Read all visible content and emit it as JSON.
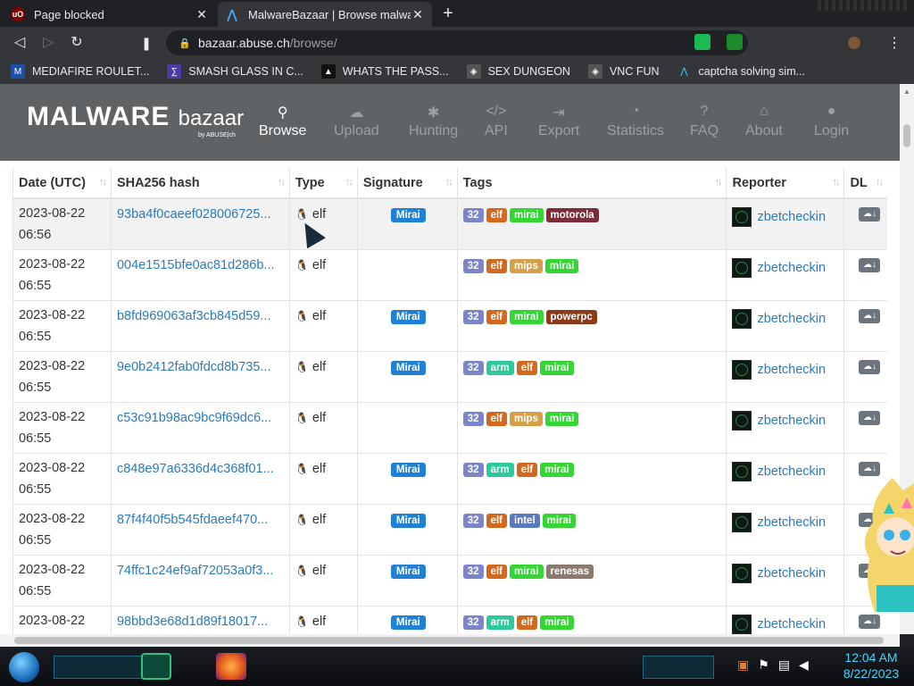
{
  "browser": {
    "tabs": [
      {
        "label": "Page blocked",
        "icon": "ublock-icon"
      },
      {
        "label": "MalwareBazaar | Browse malware s",
        "icon": "malwarebazaar-icon"
      }
    ],
    "new_tab_label": "+",
    "close_symbol": "✕",
    "url_domain": "bazaar.abuse.ch",
    "url_path": "/browse/",
    "bookmarks": [
      {
        "label": "MEDIAFIRE ROULET...",
        "icon": "mediafire-icon",
        "color": "#1d4fa8"
      },
      {
        "label": "SMASH GLASS IN C...",
        "icon": "visual-studio-icon",
        "color": "#4b3aa8"
      },
      {
        "label": "WHATS THE PASS...",
        "icon": "mask-icon",
        "color": "#222222"
      },
      {
        "label": "SEX DUNGEON",
        "icon": "cube-icon",
        "color": "#555555"
      },
      {
        "label": "VNC FUN",
        "icon": "cube-icon",
        "color": "#555555"
      },
      {
        "label": "captcha solving sim...",
        "icon": "caret-icon",
        "color": "#35363a"
      }
    ]
  },
  "site": {
    "logo_main": "MALWARE",
    "logo_sub": "bazaar",
    "logo_by": "by ABUSE|ch",
    "nav": [
      {
        "label": "Browse",
        "icon": "search-icon",
        "glyph": "🔍",
        "active": true
      },
      {
        "label": "Upload",
        "icon": "cloud-upload-icon",
        "glyph": "☁",
        "active": false
      },
      {
        "label": "Hunting",
        "icon": "bug-icon",
        "glyph": "✱",
        "active": false
      },
      {
        "label": "API",
        "icon": "code-icon",
        "glyph": "</>",
        "active": false
      },
      {
        "label": "Export",
        "icon": "export-icon",
        "glyph": "⇥",
        "active": false
      },
      {
        "label": "Statistics",
        "icon": "pie-chart-icon",
        "glyph": "◔",
        "active": false
      },
      {
        "label": "FAQ",
        "icon": "question-icon",
        "glyph": "?",
        "active": false
      },
      {
        "label": "About",
        "icon": "building-icon",
        "glyph": "⌂",
        "active": false
      },
      {
        "label": "Login",
        "icon": "user-icon",
        "glyph": "●",
        "active": false
      }
    ]
  },
  "table": {
    "headers": [
      "Date (UTC)",
      "SHA256 hash",
      "Type",
      "Signature",
      "Tags",
      "Reporter",
      "DL"
    ],
    "rows": [
      {
        "date": "2023-08-22",
        "time": "06:56",
        "hash": "93ba4f0caeef028006725...",
        "type": "elf",
        "signature": "Mirai",
        "tags": [
          "32",
          "elf",
          "mirai",
          "motorola"
        ],
        "reporter": "zbetcheckin"
      },
      {
        "date": "2023-08-22",
        "time": "06:55",
        "hash": "004e1515bfe0ac81d286b...",
        "type": "elf",
        "signature": "",
        "tags": [
          "32",
          "elf",
          "mips",
          "mirai"
        ],
        "reporter": "zbetcheckin"
      },
      {
        "date": "2023-08-22",
        "time": "06:55",
        "hash": "b8fd969063af3cb845d59...",
        "type": "elf",
        "signature": "Mirai",
        "tags": [
          "32",
          "elf",
          "mirai",
          "powerpc"
        ],
        "reporter": "zbetcheckin"
      },
      {
        "date": "2023-08-22",
        "time": "06:55",
        "hash": "9e0b2412fab0fdcd8b735...",
        "type": "elf",
        "signature": "Mirai",
        "tags": [
          "32",
          "arm",
          "elf",
          "mirai"
        ],
        "reporter": "zbetcheckin"
      },
      {
        "date": "2023-08-22",
        "time": "06:55",
        "hash": "c53c91b98ac9bc9f69dc6...",
        "type": "elf",
        "signature": "",
        "tags": [
          "32",
          "elf",
          "mips",
          "mirai"
        ],
        "reporter": "zbetcheckin"
      },
      {
        "date": "2023-08-22",
        "time": "06:55",
        "hash": "c848e97a6336d4c368f01...",
        "type": "elf",
        "signature": "Mirai",
        "tags": [
          "32",
          "arm",
          "elf",
          "mirai"
        ],
        "reporter": "zbetcheckin"
      },
      {
        "date": "2023-08-22",
        "time": "06:55",
        "hash": "87f4f40f5b545fdaeef470...",
        "type": "elf",
        "signature": "Mirai",
        "tags": [
          "32",
          "elf",
          "intel",
          "mirai"
        ],
        "reporter": "zbetcheckin"
      },
      {
        "date": "2023-08-22",
        "time": "06:55",
        "hash": "74ffc1c24ef9af72053a0f3...",
        "type": "elf",
        "signature": "Mirai",
        "tags": [
          "32",
          "elf",
          "mirai",
          "renesas"
        ],
        "reporter": "zbetcheckin"
      },
      {
        "date": "2023-08-22",
        "time": "",
        "hash": "98bbd3e68d1d89f18017...",
        "type": "elf",
        "signature": "Mirai",
        "tags": [
          "32",
          "arm",
          "elf",
          "mirai"
        ],
        "reporter": "zbetcheckin"
      }
    ]
  },
  "tag_colors": {
    "32": "#7a86c9",
    "elf": "#d2691e",
    "mirai": "#33d633",
    "motorola": "#7b2d3a",
    "mips": "#d6a04a",
    "powerpc": "#8b3a1a",
    "arm": "#2ec89a",
    "intel": "#5a7ac0",
    "renesas": "#8a7a70"
  },
  "taskbar": {
    "time": "12:04 AM",
    "date": "8/22/2023"
  }
}
